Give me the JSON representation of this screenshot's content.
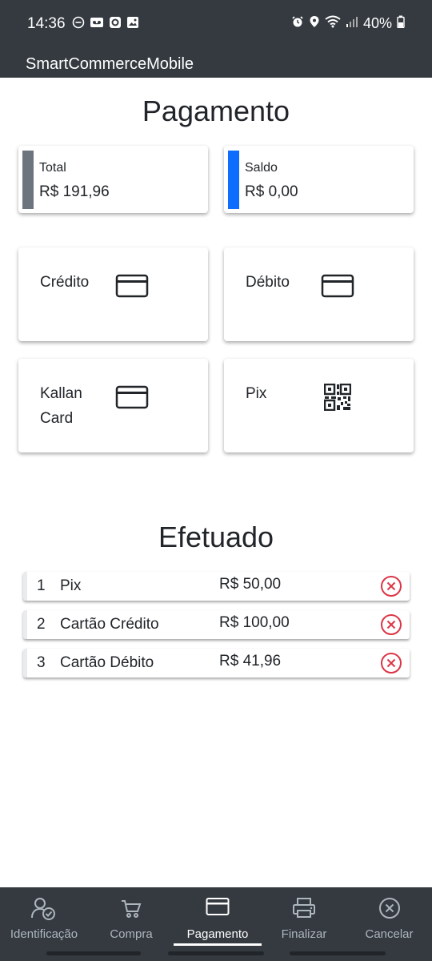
{
  "status_bar": {
    "time": "14:36",
    "battery": "40%",
    "icons": [
      "do-not-disturb-icon",
      "voicemail-icon",
      "app-icon",
      "image-icon",
      "alarm-icon",
      "location-icon",
      "wifi-icon",
      "signal-icon",
      "battery-icon"
    ]
  },
  "app": {
    "title": "SmartCommerceMobile"
  },
  "payment": {
    "title": "Pagamento",
    "total": {
      "label": "Total",
      "value": "R$ 191,96",
      "color": "#6c757d"
    },
    "balance": {
      "label": "Saldo",
      "value": "R$ 0,00",
      "color": "#0d6efd"
    },
    "methods": [
      {
        "label": "Crédito",
        "icon": "credit-card-icon"
      },
      {
        "label": "Débito",
        "icon": "credit-card-icon"
      },
      {
        "label": "Kallan Card",
        "icon": "credit-card-icon"
      },
      {
        "label": "Pix",
        "icon": "qr-code-icon"
      }
    ]
  },
  "done": {
    "title": "Efetuado",
    "rows": [
      {
        "num": "1",
        "name": "Pix",
        "amount": "R$ 50,00"
      },
      {
        "num": "2",
        "name": "Cartão Crédito",
        "amount": "R$ 100,00"
      },
      {
        "num": "3",
        "name": "Cartão Débito",
        "amount": "R$ 41,96"
      }
    ],
    "remove_color": "#dc3545"
  },
  "bottom_nav": {
    "items": [
      {
        "label": "Identificação",
        "icon": "user-check-icon"
      },
      {
        "label": "Compra",
        "icon": "cart-icon"
      },
      {
        "label": "Pagamento",
        "icon": "credit-card-icon",
        "active": true
      },
      {
        "label": "Finalizar",
        "icon": "printer-icon"
      },
      {
        "label": "Cancelar",
        "icon": "cancel-circle-icon"
      }
    ]
  }
}
